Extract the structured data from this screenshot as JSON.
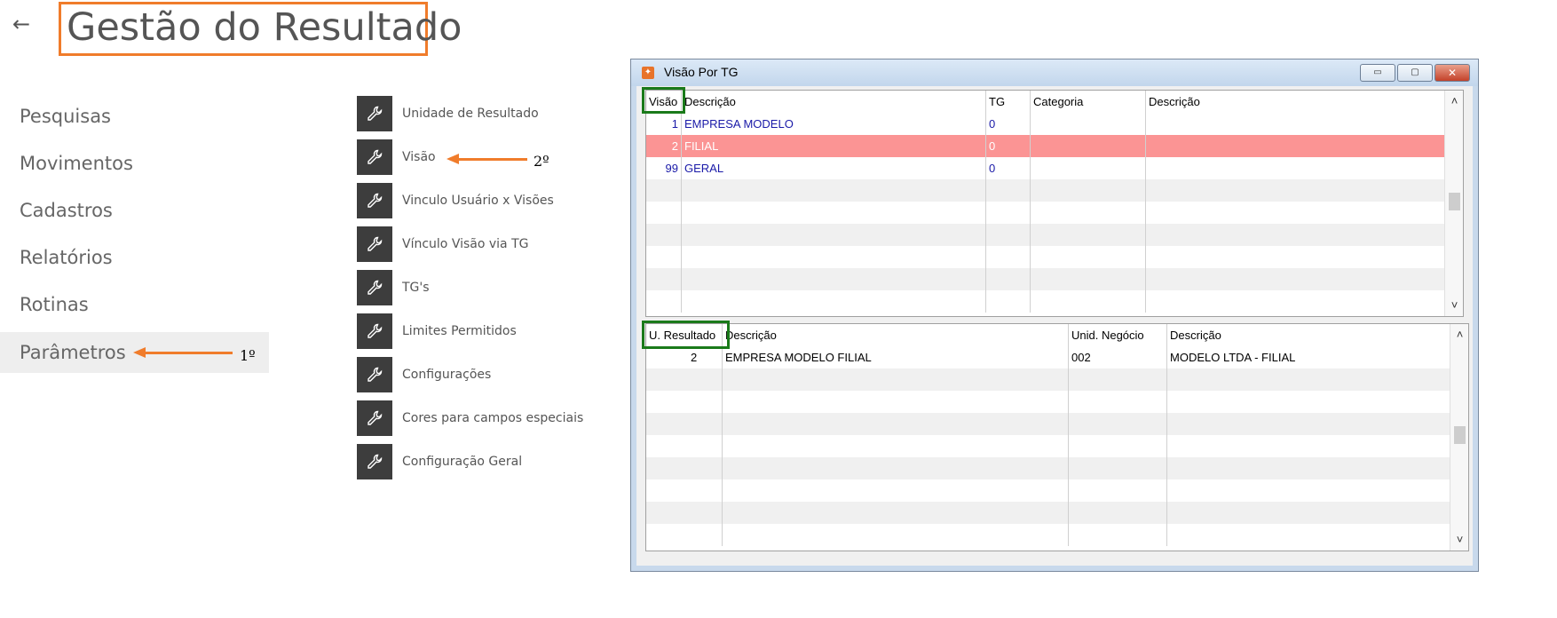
{
  "header": {
    "back_icon": "arrow-left-icon",
    "back_glyph": "←",
    "title": "Gestão do Resultado"
  },
  "nav": {
    "items": [
      {
        "label": "Pesquisas",
        "selected": false
      },
      {
        "label": "Movimentos",
        "selected": false
      },
      {
        "label": "Cadastros",
        "selected": false
      },
      {
        "label": "Relatórios",
        "selected": false
      },
      {
        "label": "Rotinas",
        "selected": false
      },
      {
        "label": "Parâmetros",
        "selected": true
      }
    ]
  },
  "annotations": {
    "step1": "1º",
    "step2": "2º",
    "arrow_color": "#f07c2b",
    "highlight_color": "#1a7a1a",
    "title_highlight_color": "#f07c2b"
  },
  "menu": {
    "icon": "wrench-icon",
    "items": [
      "Unidade de Resultado",
      "Visão",
      "Vinculo Usuário x Visões",
      "Vínculo Visão via TG",
      "TG's",
      "Limites Permitidos",
      "Configurações",
      "Cores para campos especiais",
      "Configuração Geral"
    ]
  },
  "window": {
    "title": "Visão Por TG",
    "app_icon": "app-icon",
    "minimize_glyph": "▭",
    "maximize_glyph": "▢",
    "close_glyph": "✕",
    "scroll_up_glyph": "˄",
    "scroll_down_glyph": "˅",
    "top_grid": {
      "columns": [
        "Visão",
        "Descrição",
        "TG",
        "Categoria",
        "Descrição"
      ],
      "rows": [
        {
          "visao": "1",
          "descricao": "EMPRESA MODELO",
          "tg": "0",
          "categoria": "",
          "descricao2": "",
          "selected": false
        },
        {
          "visao": "2",
          "descricao": "FILIAL",
          "tg": "0",
          "categoria": "",
          "descricao2": "",
          "selected": true
        },
        {
          "visao": "99",
          "descricao": "GERAL",
          "tg": "0",
          "categoria": "",
          "descricao2": "",
          "selected": false
        }
      ],
      "selected_color": "#fb9494"
    },
    "bottom_grid": {
      "columns": [
        "U. Resultado",
        "Descrição",
        "Unid. Negócio",
        "Descrição"
      ],
      "rows": [
        {
          "u_resultado": "2",
          "descricao": "EMPRESA MODELO FILIAL",
          "unid_negocio": "002",
          "descricao2": "MODELO LTDA - FILIAL"
        }
      ]
    }
  }
}
